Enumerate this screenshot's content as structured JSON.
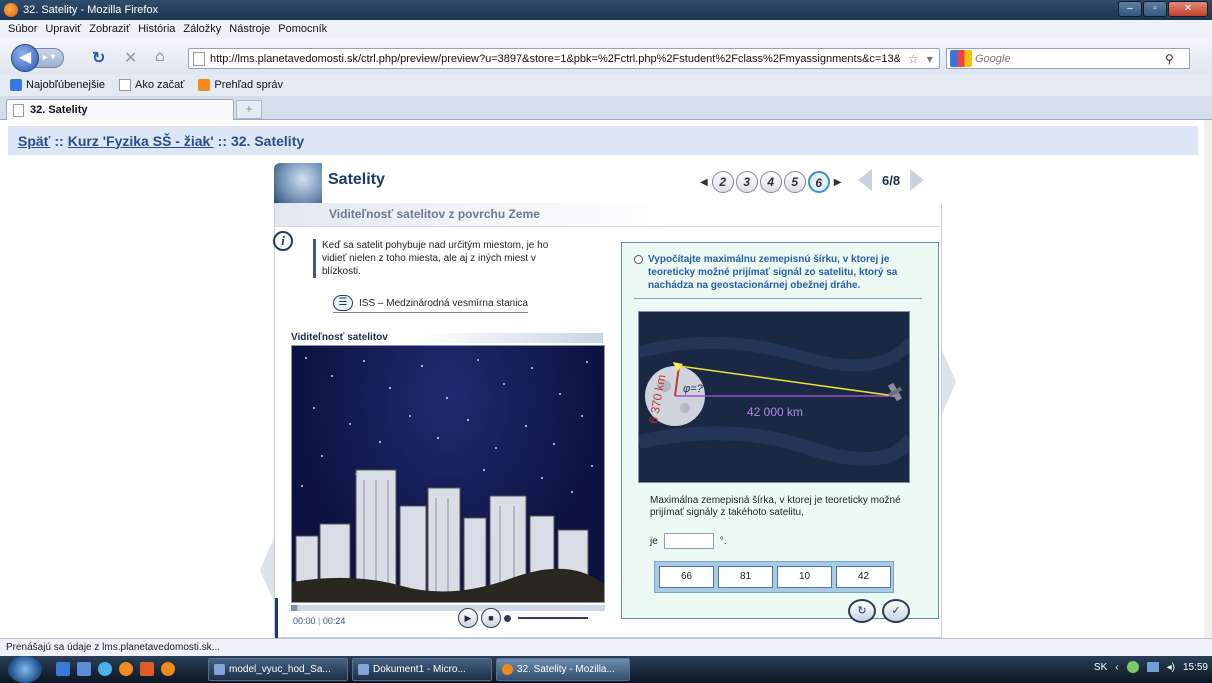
{
  "window": {
    "title": "32. Satelity - Mozilla Firefox",
    "buttons": [
      "–",
      "▫",
      "✕"
    ]
  },
  "menu": [
    "Súbor",
    "Upraviť",
    "Zobraziť",
    "História",
    "Záložky",
    "Nástroje",
    "Pomocník"
  ],
  "nav": {
    "url": "http://lms.planetavedomosti.sk/ctrl.php/preview/preview?u=3897&store=1&pbk=%2Fctrl.php%2Fstudent%2Fclass%2Fmyassignments&c=13&nod",
    "search_placeholder": "Google"
  },
  "bookmarks": [
    "Najobľúbenejšie",
    "Ako začať",
    "Prehľad správ"
  ],
  "tab": {
    "label": "32. Satelity",
    "new_tab": "+"
  },
  "breadcrumb": {
    "back": "Späť",
    "sep": "::",
    "course": "Kurz 'Fyzika SŠ - žiak'",
    "current": "32. Satelity"
  },
  "lesson": {
    "title": "Satelity",
    "pages": [
      "2",
      "3",
      "4",
      "5",
      "6"
    ],
    "active_page": "6",
    "page_count": "6/8",
    "subtitle": "Viditeľnosť satelitov z povrchu Zeme",
    "intro": "Keď sa satelit pohybuje nad určitým miestom, je ho vidieť nielen z toho miesta, ale aj z iných miest v blízkosti.",
    "iss_link": "ISS – Medzinárodná vesmírna stanica",
    "video_label": "Viditeľnosť satelitov",
    "video_time_current": "00:00",
    "video_time_sep": "|",
    "video_time_total": "00:24"
  },
  "task": {
    "question": "Vypočítajte maximálnu zemepisnú šírku, v ktorej je teoreticky možné prijímať signál zo satelitu, ktorý sa nachádza na geostacionárnej obežnej dráhe.",
    "diagram": {
      "radius": "6 370 km",
      "angle": "φ=?",
      "distance": "42 000 km"
    },
    "answer_text": "Maximálna zemepisná šírka, v ktorej je teoreticky možné prijímať signály z takéhoto satelitu,",
    "je_label": "je",
    "degree": "°.",
    "options": [
      "66",
      "81",
      "10",
      "42"
    ]
  },
  "status": "Prenášajú sa údaje z lms.planetavedomosti.sk...",
  "taskbar": {
    "items": [
      "model_vyuc_hod_Sa...",
      "Dokument1 - Micro...",
      "32. Satelity - Mozilla..."
    ],
    "lang": "SK",
    "clock": "15:59"
  }
}
